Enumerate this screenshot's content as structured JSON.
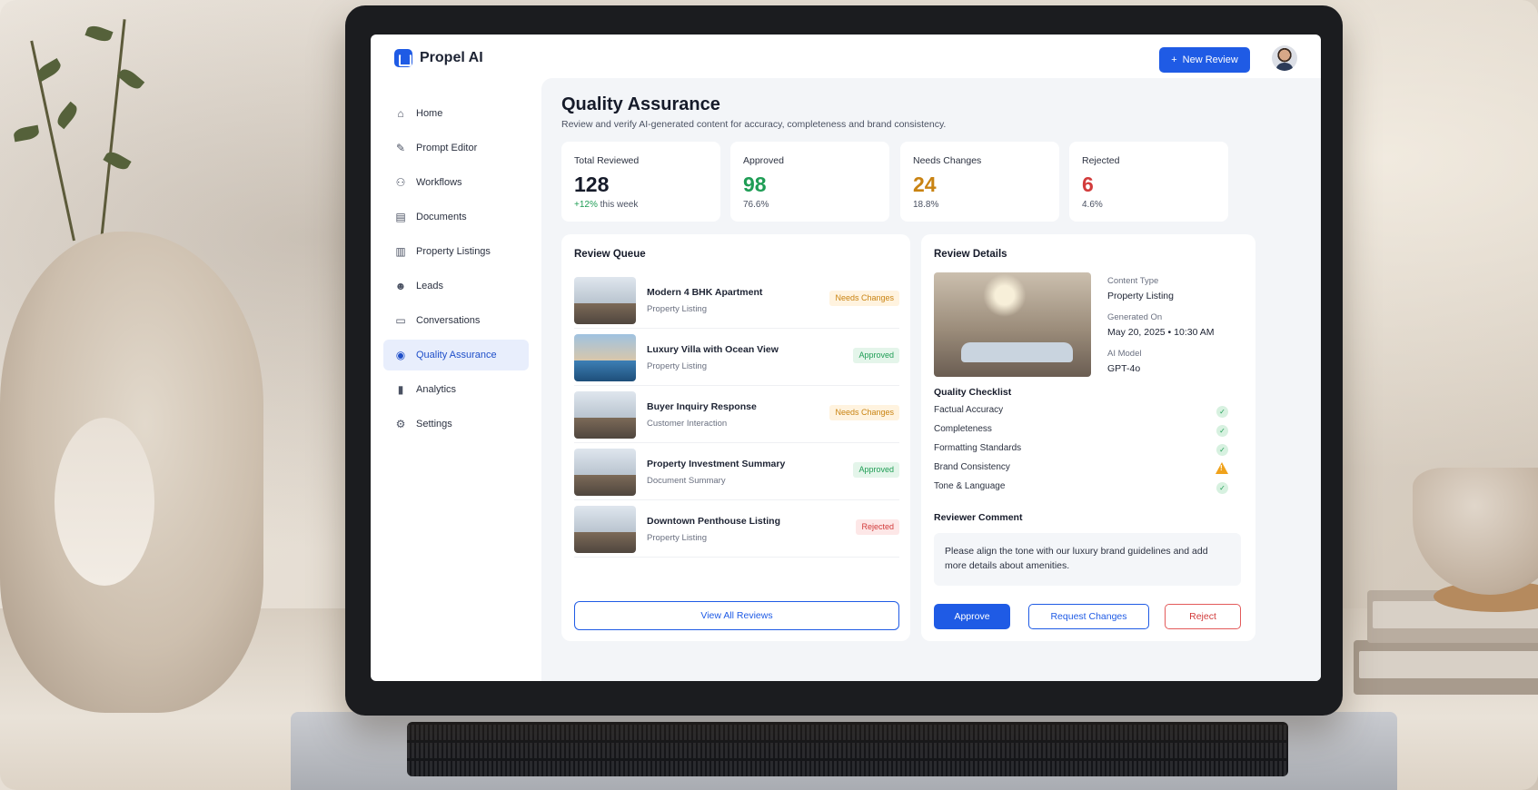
{
  "app": {
    "name": "Propel AI",
    "new_review_label": "New Review"
  },
  "sidebar": {
    "items": [
      {
        "label": "Home",
        "icon": "home-icon",
        "glyph": "⌂"
      },
      {
        "label": "Prompt Editor",
        "icon": "edit-icon",
        "glyph": "✎"
      },
      {
        "label": "Workflows",
        "icon": "workflow-icon",
        "glyph": "⚇"
      },
      {
        "label": "Documents",
        "icon": "document-icon",
        "glyph": "▤"
      },
      {
        "label": "Property Listings",
        "icon": "building-icon",
        "glyph": "▥"
      },
      {
        "label": "Leads",
        "icon": "users-icon",
        "glyph": "☻"
      },
      {
        "label": "Conversations",
        "icon": "chat-icon",
        "glyph": "▭"
      },
      {
        "label": "Quality Assurance",
        "icon": "shield-check-icon",
        "glyph": "◉",
        "active": true
      },
      {
        "label": "Analytics",
        "icon": "bar-chart-icon",
        "glyph": "▮"
      },
      {
        "label": "Settings",
        "icon": "gear-icon",
        "glyph": "⚙"
      }
    ]
  },
  "header": {
    "title": "Quality Assurance",
    "subtitle": "Review and verify AI-generated content for accuracy, completeness and brand consistency."
  },
  "stats": [
    {
      "label": "Total Reviewed",
      "value": "128",
      "delta": "+12%",
      "foot": "this week",
      "color": "#161b2a"
    },
    {
      "label": "Approved",
      "value": "98",
      "foot": "76.6%",
      "color": "#1f9d55"
    },
    {
      "label": "Needs Changes",
      "value": "24",
      "foot": "18.8%",
      "color": "#c98312"
    },
    {
      "label": "Rejected",
      "value": "6",
      "foot": "4.6%",
      "color": "#d23b3b"
    }
  ],
  "queue": {
    "title": "Review Queue",
    "items": [
      {
        "title": "Modern 4 BHK Apartment",
        "type": "Property Listing",
        "status": "Needs Changes",
        "kind": "changes"
      },
      {
        "title": "Luxury Villa with Ocean View",
        "type": "Property Listing",
        "status": "Approved",
        "kind": "approved"
      },
      {
        "title": "Buyer Inquiry Response",
        "type": "Customer Interaction",
        "status": "Needs Changes",
        "kind": "changes"
      },
      {
        "title": "Property Investment Summary",
        "type": "Document Summary",
        "status": "Approved",
        "kind": "approved"
      },
      {
        "title": "Downtown Penthouse Listing",
        "type": "Property Listing",
        "status": "Rejected",
        "kind": "rejected"
      }
    ],
    "view_all_label": "View All Reviews"
  },
  "details": {
    "title": "Review Details",
    "content_type_label": "Content Type",
    "content_type": "Property Listing",
    "generated_on_label": "Generated On",
    "generated_on": "May 20, 2025 • 10:30 AM",
    "ai_model_label": "AI Model",
    "ai_model": "GPT-4o",
    "checklist_title": "Quality Checklist",
    "checklist": [
      {
        "label": "Factual Accuracy",
        "state": "pass"
      },
      {
        "label": "Completeness",
        "state": "pass"
      },
      {
        "label": "Formatting Standards",
        "state": "pass"
      },
      {
        "label": "Brand Consistency",
        "state": "warn"
      },
      {
        "label": "Tone & Language",
        "state": "pass"
      }
    ],
    "comment_title": "Reviewer Comment",
    "comment": "Please align the tone with our luxury brand guidelines and add more details about amenities.",
    "approve_label": "Approve",
    "request_changes_label": "Request Changes",
    "reject_label": "Reject"
  }
}
